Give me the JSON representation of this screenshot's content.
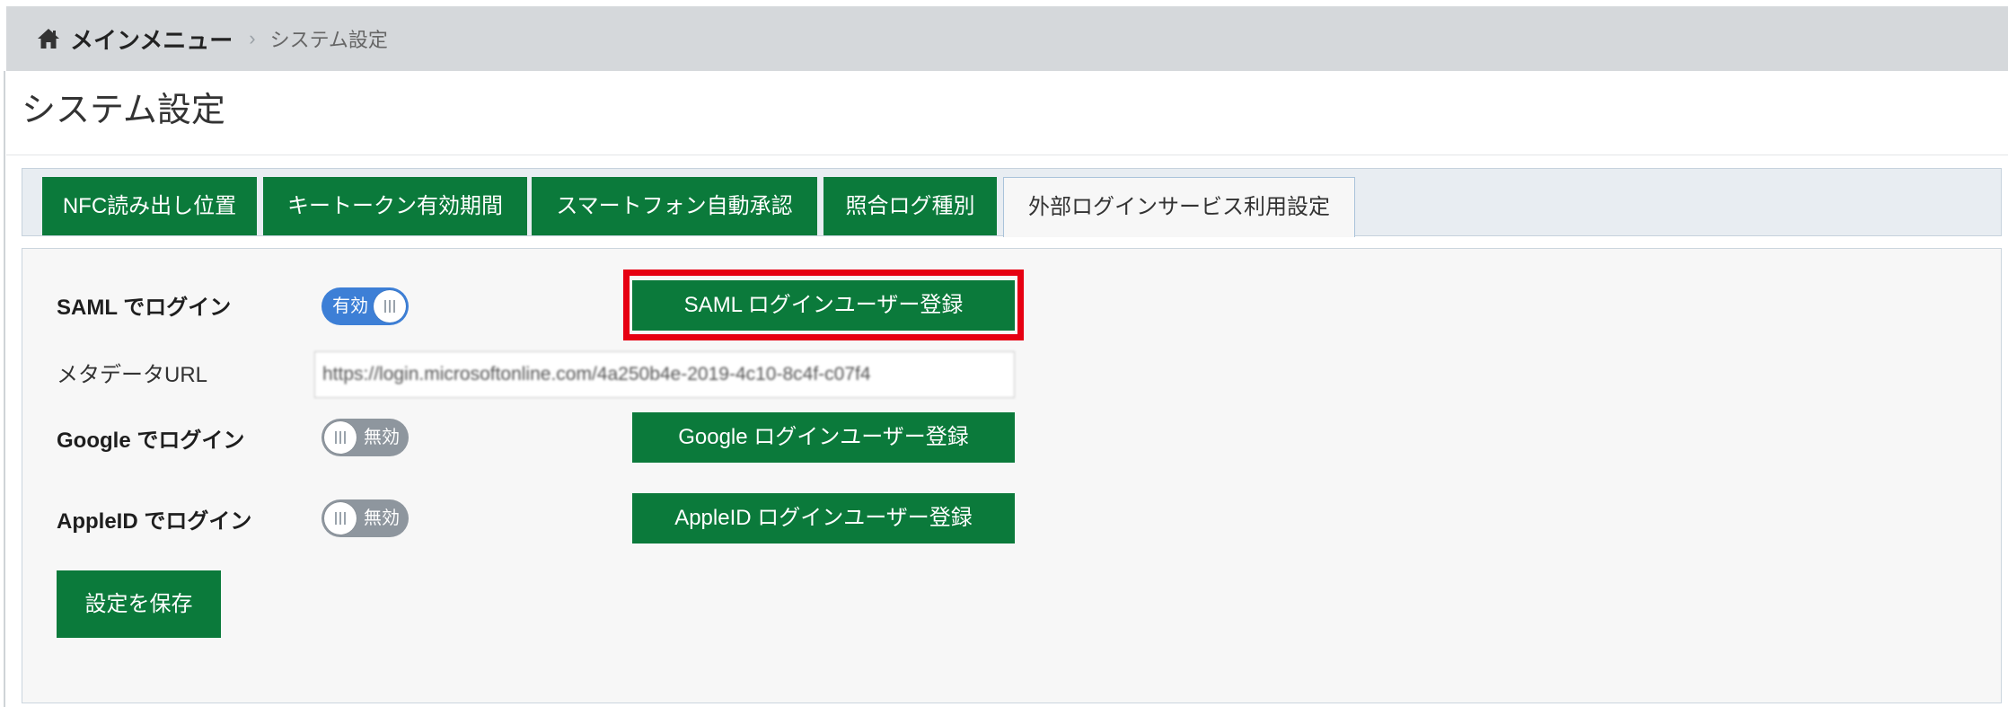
{
  "breadcrumb": {
    "home_icon": "home-icon",
    "home_label": "メインメニュー",
    "separator": "›",
    "current": "システム設定"
  },
  "page_title": "システム設定",
  "tabs": [
    {
      "label": "NFC読み出し位置",
      "active": false
    },
    {
      "label": "キートークン有効期間",
      "active": false
    },
    {
      "label": "スマートフォン自動承認",
      "active": false
    },
    {
      "label": "照合ログ種別",
      "active": false
    },
    {
      "label": "外部ログインサービス利用設定",
      "active": true
    }
  ],
  "settings": {
    "saml": {
      "label": "SAML でログイン",
      "enabled": true,
      "toggle_text": "有効",
      "button": "SAML ログインユーザー登録"
    },
    "metadata_url": {
      "label": "メタデータURL",
      "value": "https://login.microsoftonline.com/4a250b4e-2019-4c10-8c4f-c07f4"
    },
    "google": {
      "label": "Google でログイン",
      "enabled": false,
      "toggle_text": "無効",
      "button": "Google ログインユーザー登録"
    },
    "appleid": {
      "label": "AppleID でログイン",
      "enabled": false,
      "toggle_text": "無効",
      "button": "AppleID ログインユーザー登録"
    }
  },
  "save_button": "設定を保存",
  "colors": {
    "primary_green": "#0b7a3b",
    "toggle_on": "#3d7fd6",
    "toggle_off": "#8e969e",
    "highlight_red": "#e60012",
    "breadcrumb_bg": "#d5d8db"
  }
}
